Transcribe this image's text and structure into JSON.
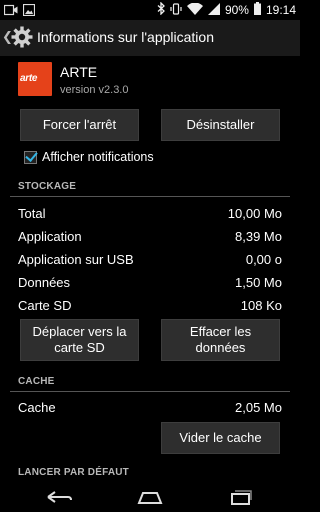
{
  "status_bar": {
    "battery": "90%",
    "time": "19:14",
    "left_icons": [
      "video-call-icon",
      "image-icon"
    ],
    "right_icons": [
      "bluetooth-icon",
      "vibrate-icon",
      "wifi-icon",
      "signal-icon",
      "battery-icon"
    ]
  },
  "action_bar": {
    "title": "Informations sur l'application",
    "up_icon": "chevron-left-icon",
    "app_icon": "gear-icon"
  },
  "app": {
    "logo_text": "arte",
    "name": "ARTE",
    "version": "version v2.3.0"
  },
  "buttons": {
    "force_stop": "Forcer l'arrêt",
    "uninstall": "Désinstaller",
    "move_to_sd_line1": "Déplacer vers la",
    "move_to_sd_line2": "carte SD",
    "clear_data_line1": "Effacer les",
    "clear_data_line2": "données",
    "clear_cache": "Vider le cache"
  },
  "notifications": {
    "label": "Afficher notifications",
    "checked": true
  },
  "storage": {
    "header": "STOCKAGE",
    "rows": [
      {
        "label": "Total",
        "value": "10,00 Mo"
      },
      {
        "label": "Application",
        "value": "8,39 Mo"
      },
      {
        "label": "Application sur USB",
        "value": "0,00 o"
      },
      {
        "label": "Données",
        "value": "1,50 Mo"
      },
      {
        "label": "Carte SD",
        "value": "108 Ko"
      }
    ]
  },
  "cache": {
    "header": "CACHE",
    "label": "Cache",
    "value": "2,05 Mo"
  },
  "launch_default": {
    "header": "LANCER PAR DÉFAUT"
  },
  "colors": {
    "accent": "#33b5e5",
    "arte_orange": "#e5421a"
  }
}
